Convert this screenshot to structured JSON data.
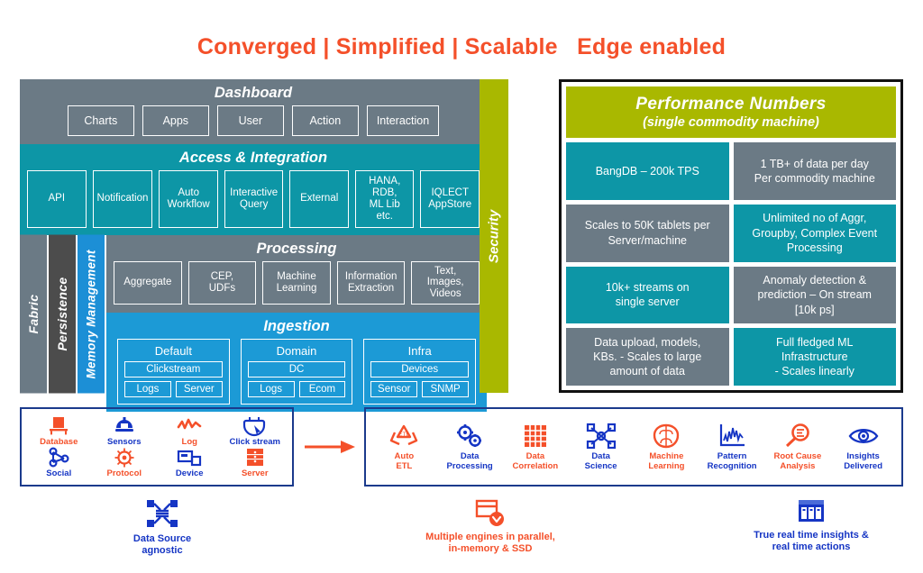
{
  "headline": "Converged | Simplified | Scalable   Edge enabled",
  "headline_color": "#F4502A",
  "architecture": {
    "dashboard": {
      "title": "Dashboard",
      "color": "#6B7A85",
      "items": [
        "Charts",
        "Apps",
        "User",
        "Action",
        "Interaction"
      ]
    },
    "access": {
      "title": "Access & Integration",
      "color": "#0D96A6",
      "items": [
        "API",
        "Notification",
        "Auto\nWorkflow",
        "Interactive\nQuery",
        "External",
        "HANA, RDB,\nML Lib etc.",
        "IQLECT\nAppStore"
      ]
    },
    "vertical_bars": [
      {
        "label": "Fabric",
        "color": "#6B7A85"
      },
      {
        "label": "Persistence",
        "color": "#4C4C4C"
      },
      {
        "label": "Memory Management",
        "color": "#1C8FD6"
      }
    ],
    "processing": {
      "title": "Processing",
      "color": "#6B7A85",
      "items": [
        "Aggregate",
        "CEP,\nUDFs",
        "Machine\nLearning",
        "Information\nExtraction",
        "Text,\nImages,\nVideos"
      ]
    },
    "ingestion": {
      "title": "Ingestion",
      "color": "#1C9AD6",
      "groups": [
        {
          "title": "Default",
          "wide": "Clickstream",
          "pair": [
            "Logs",
            "Server"
          ]
        },
        {
          "title": "Domain",
          "wide": "DC",
          "pair": [
            "Logs",
            "Ecom"
          ]
        },
        {
          "title": "Infra",
          "wide": "Devices",
          "pair": [
            "Sensor",
            "SNMP"
          ]
        }
      ]
    },
    "security": {
      "label": "Security",
      "color": "#A9B800"
    }
  },
  "performance": {
    "title": "Performance  Numbers",
    "subtitle": "(single commodity machine)",
    "header_color": "#A9B800",
    "rows": [
      [
        {
          "text": "BangDB – 200k TPS",
          "style": "teal"
        },
        {
          "text": "1 TB+ of data per day\nPer commodity machine",
          "style": "gray"
        }
      ],
      [
        {
          "text": "Scales to 50K tablets per\nServer/machine",
          "style": "gray"
        },
        {
          "text": "Unlimited no of Aggr,\nGroupby, Complex Event\nProcessing",
          "style": "teal"
        }
      ],
      [
        {
          "text": "10k+ streams on\nsingle server",
          "style": "teal"
        },
        {
          "text": "Anomaly detection &\nprediction – On stream\n[10k ps]",
          "style": "gray"
        }
      ],
      [
        {
          "text": "Data upload, models,\nKBs. - Scales to large\namount of data",
          "style": "gray"
        },
        {
          "text": "Full fledged ML\nInfrastructure\n- Scales linearly",
          "style": "teal"
        }
      ]
    ]
  },
  "data_sources": {
    "border_color": "#1B3A8C",
    "items": [
      {
        "label": "Database",
        "icon": "database-icon",
        "color": "#F4502A"
      },
      {
        "label": "Sensors",
        "icon": "sensor-icon",
        "color": "#1535C4"
      },
      {
        "label": "Log",
        "icon": "log-icon",
        "color": "#F4502A"
      },
      {
        "label": "Click stream",
        "icon": "clickstream-icon",
        "color": "#1535C4"
      },
      {
        "label": "Social",
        "icon": "social-share-icon",
        "color": "#1535C4"
      },
      {
        "label": "Protocol",
        "icon": "protocol-icon",
        "color": "#F4502A"
      },
      {
        "label": "Device",
        "icon": "device-icon",
        "color": "#1535C4"
      },
      {
        "label": "Server",
        "icon": "server-icon",
        "color": "#F4502A"
      }
    ]
  },
  "arrow": {
    "name": "flow-arrow",
    "color": "#F4502A"
  },
  "engines": {
    "border_color": "#1B3A8C",
    "items": [
      {
        "label": "Auto\nETL",
        "icon": "recycle-etl-icon",
        "color": "#F4502A"
      },
      {
        "label": "Data\nProcessing",
        "icon": "gears-icon",
        "color": "#1535C4"
      },
      {
        "label": "Data\nCorrelation",
        "icon": "grid-matrix-icon",
        "color": "#F4502A"
      },
      {
        "label": "Data\nScience",
        "icon": "network-nodes-icon",
        "color": "#1535C4"
      },
      {
        "label": "Machine\nLearning",
        "icon": "brain-icon",
        "color": "#F4502A"
      },
      {
        "label": "Pattern\nRecognition",
        "icon": "line-chart-icon",
        "color": "#1535C4"
      },
      {
        "label": "Root Cause\nAnalysis",
        "icon": "magnifier-icon",
        "color": "#F4502A"
      },
      {
        "label": "Insights\nDelivered",
        "icon": "eye-icon",
        "color": "#1535C4"
      }
    ]
  },
  "captions": [
    {
      "label": "Data Source\nagnostic",
      "icon": "data-source-agnostic-icon",
      "color": "#1535C4"
    },
    {
      "label": "Multiple engines in parallel,\nin-memory & SSD",
      "icon": "parallel-engine-icon",
      "color": "#F4502A"
    },
    {
      "label": "True real time insights &\nreal time actions",
      "icon": "realtime-dashboard-icon",
      "color": "#1535C4"
    }
  ]
}
